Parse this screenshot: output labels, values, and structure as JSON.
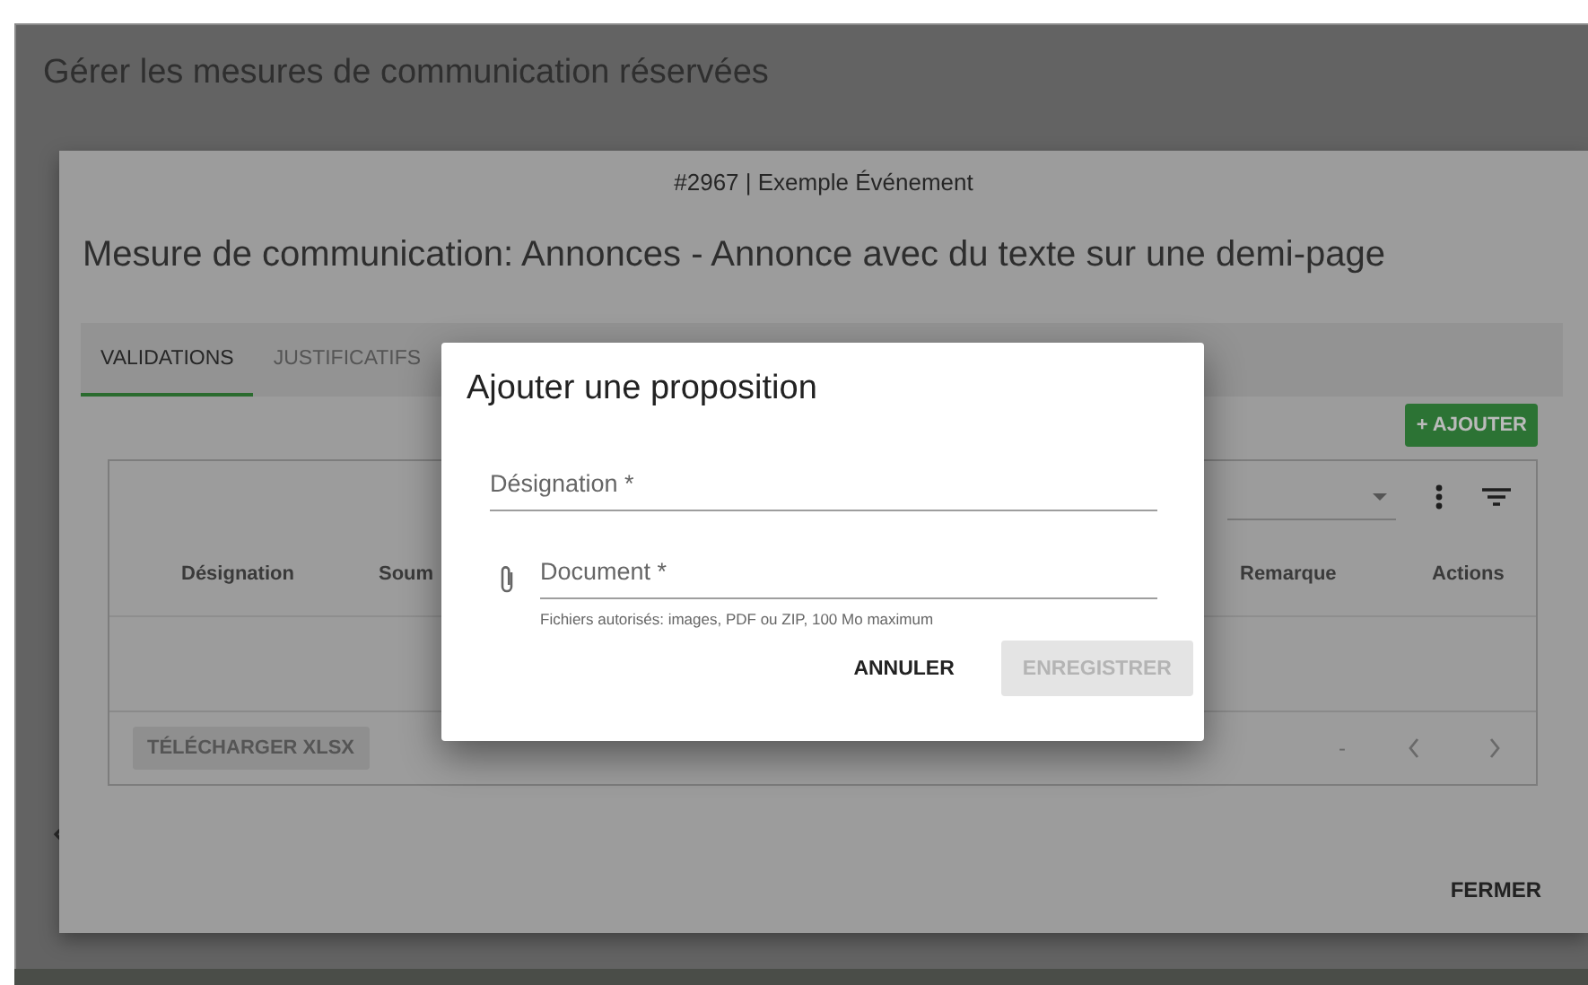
{
  "page": {
    "title": "Gérer les mesures de communication réservées"
  },
  "modal": {
    "event": "#2967 | Exemple Événement",
    "title": "Mesure de communication: Annonces - Annonce avec du texte sur une demi-page",
    "tabs": [
      {
        "label": "VALIDATIONS",
        "selected": true
      },
      {
        "label": "JUSTIFICATIFS",
        "selected": false
      }
    ],
    "add_button": "+ AJOUTER",
    "table": {
      "columns": [
        "Désignation",
        "Soum",
        "Remarque",
        "Actions"
      ],
      "export_button": {
        "label": "TÉLÉCHARGER XLSX",
        "disabled": true
      },
      "pagination": "-"
    },
    "close_button": "FERMER"
  },
  "dialog": {
    "title": "Ajouter une proposition",
    "fields": [
      {
        "kind": "text",
        "placeholder": "Désignation *"
      },
      {
        "kind": "file",
        "placeholder": "Document *",
        "hint": "Fichiers autorisés: images, PDF ou ZIP, 100 Mo maximum"
      }
    ],
    "buttons": [
      {
        "label": "ANNULER",
        "disabled": false
      },
      {
        "label": "ENREGISTRER",
        "disabled": true
      }
    ]
  }
}
